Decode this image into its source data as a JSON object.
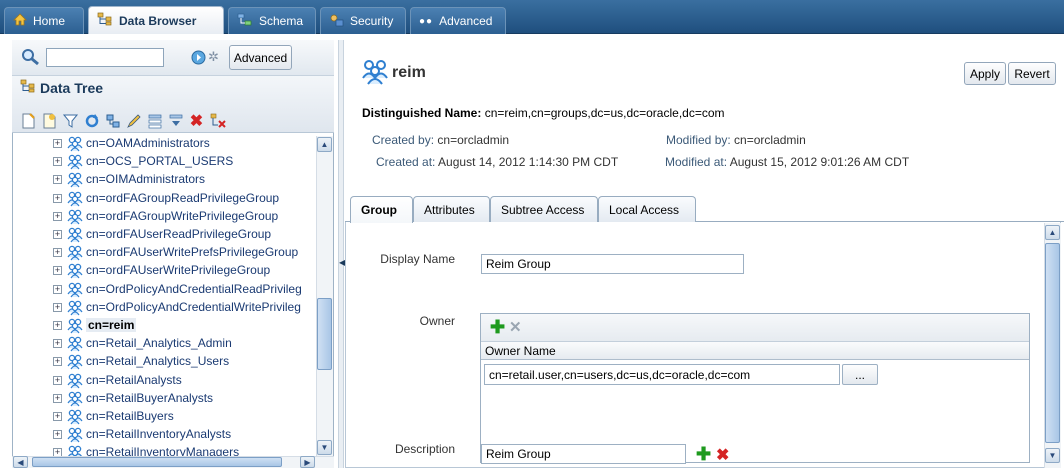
{
  "top_tabs": [
    {
      "label": "Home",
      "icon": "home-icon"
    },
    {
      "label": "Data Browser",
      "icon": "data-tree-icon"
    },
    {
      "label": "Schema",
      "icon": "schema-icon"
    },
    {
      "label": "Security",
      "icon": "security-icon"
    },
    {
      "label": "Advanced",
      "icon": "advanced-icon"
    }
  ],
  "left": {
    "search_value": "",
    "advanced_label": "Advanced",
    "tree_title": "Data Tree",
    "tree_items": [
      "cn=OAMAdministrators",
      "cn=OCS_PORTAL_USERS",
      "cn=OIMAdministrators",
      "cn=ordFAGroupReadPrivilegeGroup",
      "cn=ordFAGroupWritePrivilegeGroup",
      "cn=ordFAUserReadPrivilegeGroup",
      "cn=ordFAUserWritePrefsPrivilegeGroup",
      "cn=ordFAUserWritePrivilegeGroup",
      "cn=OrdPolicyAndCredentialReadPrivileg",
      "cn=OrdPolicyAndCredentialWritePrivileg",
      "cn=reim",
      "cn=Retail_Analytics_Admin",
      "cn=Retail_Analytics_Users",
      "cn=RetailAnalysts",
      "cn=RetailBuyerAnalysts",
      "cn=RetailBuyers",
      "cn=RetailInventoryAnalysts",
      "cn=RetailInventoryManagers"
    ],
    "selected_item": "cn=reim"
  },
  "entry": {
    "title": "reim",
    "apply_label": "Apply",
    "revert_label": "Revert",
    "dn_label": "Distinguished Name:",
    "dn_value": "cn=reim,cn=groups,dc=us,dc=oracle,dc=com",
    "created_by_label": "Created by:",
    "created_by": "cn=orcladmin",
    "created_at_label": "Created at:",
    "created_at": "August 14, 2012 1:14:30 PM CDT",
    "modified_by_label": "Modified by:",
    "modified_by": "cn=orcladmin",
    "modified_at_label": "Modified at:",
    "modified_at": "August 15, 2012 9:01:26 AM CDT"
  },
  "content_tabs": [
    "Group",
    "Attributes",
    "Subtree Access",
    "Local Access"
  ],
  "form": {
    "display_name_label": "Display Name",
    "display_name_value": "Reim Group",
    "owner_label": "Owner",
    "owner_column": "Owner Name",
    "owner_value": "cn=retail.user,cn=users,dc=us,dc=oracle,dc=com",
    "browse_label": "...",
    "description_label": "Description",
    "description_value": "Reim Group"
  }
}
